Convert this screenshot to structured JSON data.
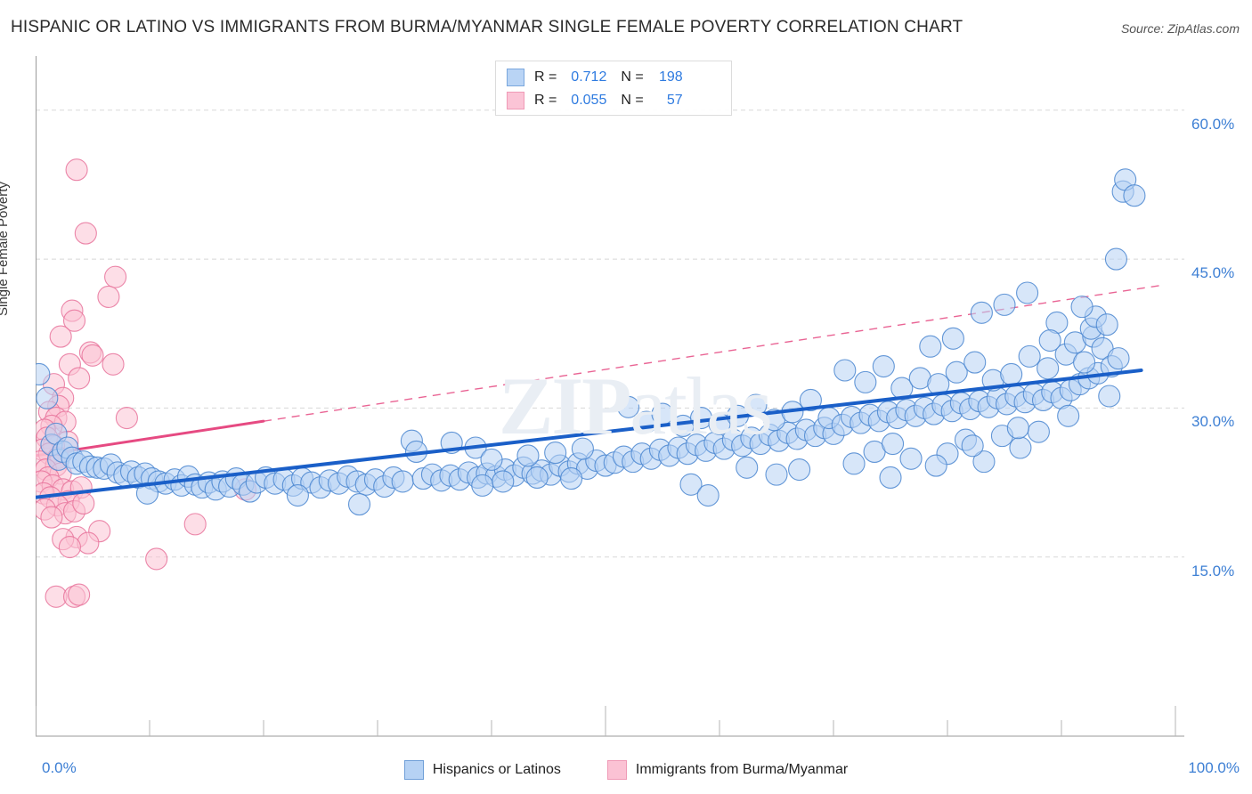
{
  "header": {
    "title": "HISPANIC OR LATINO VS IMMIGRANTS FROM BURMA/MYANMAR SINGLE FEMALE POVERTY CORRELATION CHART",
    "source": "Source: ZipAtlas.com"
  },
  "watermark": {
    "part1": "ZIP",
    "part2": "atlas"
  },
  "correlation_legend": {
    "rows": [
      {
        "color": "#b9d4f5",
        "r_label": "R =",
        "r_value": "0.712",
        "n_label": "N =",
        "n_value": "198"
      },
      {
        "color": "#fbc4d6",
        "r_label": "R =",
        "r_value": "0.055",
        "n_label": "N =",
        "n_value": "57"
      }
    ]
  },
  "series_legend": [
    {
      "name": "Hispanics or Latinos",
      "color": "#b6d2f4"
    },
    {
      "name": "Immigrants from Burma/Myanmar",
      "color": "#fbc2d4"
    }
  ],
  "axes": {
    "y_title": "Single Female Poverty",
    "y_ticks": [
      "60.0%",
      "45.0%",
      "30.0%",
      "15.0%"
    ],
    "x_min_label": "0.0%",
    "x_max_label": "100.0%"
  },
  "chart_data": {
    "type": "scatter",
    "title": "HISPANIC OR LATINO VS IMMIGRANTS FROM BURMA/MYANMAR SINGLE FEMALE POVERTY CORRELATION CHART",
    "xlabel": "",
    "ylabel": "Single Female Poverty",
    "xlim": [
      0,
      100
    ],
    "ylim": [
      0,
      65
    ],
    "x_ticks": [
      0,
      100
    ],
    "y_ticks": [
      15,
      30,
      45,
      60
    ],
    "grid": "horizontal-dashed",
    "legend_position": "bottom-center",
    "series": [
      {
        "name": "Hispanics or Latinos",
        "color": "#b6d2f4",
        "edge_color": "#4a86d0",
        "r": 0.712,
        "n": 198,
        "trendline": {
          "style": "solid",
          "color": "#1a5fc8",
          "x0": 0,
          "y0": 21.0,
          "x1": 97,
          "y1": 33.8
        },
        "points": [
          [
            0.3,
            33.4
          ],
          [
            1.0,
            31.0
          ],
          [
            1.4,
            26.3
          ],
          [
            1.8,
            27.4
          ],
          [
            2.0,
            24.8
          ],
          [
            2.4,
            25.6
          ],
          [
            2.8,
            26.0
          ],
          [
            3.2,
            25.0
          ],
          [
            3.6,
            24.4
          ],
          [
            4.2,
            24.6
          ],
          [
            4.8,
            24.1
          ],
          [
            5.4,
            24.0
          ],
          [
            6.0,
            23.9
          ],
          [
            6.6,
            24.3
          ],
          [
            7.2,
            23.5
          ],
          [
            7.8,
            23.2
          ],
          [
            8.4,
            23.6
          ],
          [
            9.0,
            23.0
          ],
          [
            9.6,
            23.4
          ],
          [
            10.2,
            22.9
          ],
          [
            10.8,
            22.6
          ],
          [
            11.4,
            22.4
          ],
          [
            9.8,
            21.4
          ],
          [
            12.2,
            22.8
          ],
          [
            12.8,
            22.2
          ],
          [
            13.4,
            23.1
          ],
          [
            14.0,
            22.3
          ],
          [
            14.6,
            22.0
          ],
          [
            15.2,
            22.5
          ],
          [
            15.8,
            21.8
          ],
          [
            16.4,
            22.6
          ],
          [
            17.0,
            22.1
          ],
          [
            17.6,
            22.9
          ],
          [
            18.2,
            22.3
          ],
          [
            18.8,
            21.6
          ],
          [
            19.4,
            22.5
          ],
          [
            20.2,
            23.0
          ],
          [
            21.0,
            22.4
          ],
          [
            21.8,
            22.8
          ],
          [
            22.6,
            22.2
          ],
          [
            23.4,
            22.9
          ],
          [
            24.2,
            22.5
          ],
          [
            25.0,
            22.0
          ],
          [
            25.8,
            22.7
          ],
          [
            26.6,
            22.4
          ],
          [
            27.4,
            23.1
          ],
          [
            28.2,
            22.6
          ],
          [
            23.0,
            21.2
          ],
          [
            29.0,
            22.3
          ],
          [
            29.8,
            22.8
          ],
          [
            30.6,
            22.1
          ],
          [
            31.4,
            23.0
          ],
          [
            28.4,
            20.3
          ],
          [
            32.2,
            22.6
          ],
          [
            33.0,
            26.7
          ],
          [
            33.4,
            25.6
          ],
          [
            34.0,
            22.9
          ],
          [
            34.8,
            23.3
          ],
          [
            35.6,
            22.7
          ],
          [
            36.4,
            23.2
          ],
          [
            37.2,
            22.8
          ],
          [
            38.0,
            23.5
          ],
          [
            38.8,
            23.0
          ],
          [
            39.6,
            23.4
          ],
          [
            40.4,
            23.1
          ],
          [
            41.2,
            23.8
          ],
          [
            42.0,
            23.2
          ],
          [
            42.8,
            24.0
          ],
          [
            43.6,
            23.4
          ],
          [
            44.4,
            23.7
          ],
          [
            45.2,
            23.3
          ],
          [
            46.0,
            24.2
          ],
          [
            46.8,
            23.6
          ],
          [
            47.6,
            24.4
          ],
          [
            48.4,
            23.9
          ],
          [
            49.2,
            24.7
          ],
          [
            50.0,
            24.2
          ],
          [
            36.5,
            26.5
          ],
          [
            38.6,
            26.0
          ],
          [
            39.2,
            22.2
          ],
          [
            40.0,
            24.8
          ],
          [
            41.0,
            22.6
          ],
          [
            43.2,
            25.2
          ],
          [
            44.0,
            23.0
          ],
          [
            45.6,
            25.5
          ],
          [
            47.0,
            22.9
          ],
          [
            48.0,
            25.9
          ],
          [
            50.8,
            24.5
          ],
          [
            51.6,
            25.1
          ],
          [
            52.4,
            24.6
          ],
          [
            53.2,
            25.4
          ],
          [
            54.0,
            24.9
          ],
          [
            54.8,
            25.8
          ],
          [
            55.6,
            25.2
          ],
          [
            56.4,
            26.0
          ],
          [
            57.2,
            25.4
          ],
          [
            58.0,
            26.3
          ],
          [
            58.8,
            25.7
          ],
          [
            59.6,
            26.5
          ],
          [
            60.4,
            25.9
          ],
          [
            61.2,
            26.8
          ],
          [
            62.0,
            26.2
          ],
          [
            62.8,
            27.0
          ],
          [
            63.6,
            26.4
          ],
          [
            64.4,
            27.3
          ],
          [
            65.2,
            26.7
          ],
          [
            66.0,
            27.5
          ],
          [
            66.8,
            26.9
          ],
          [
            67.6,
            27.8
          ],
          [
            68.4,
            27.2
          ],
          [
            69.2,
            28.0
          ],
          [
            70.0,
            27.4
          ],
          [
            52.0,
            30.1
          ],
          [
            53.6,
            28.6
          ],
          [
            55.0,
            29.4
          ],
          [
            56.8,
            28.2
          ],
          [
            58.4,
            29.0
          ],
          [
            60.0,
            28.4
          ],
          [
            61.6,
            29.2
          ],
          [
            63.2,
            30.3
          ],
          [
            64.8,
            28.8
          ],
          [
            66.4,
            29.6
          ],
          [
            68.0,
            30.8
          ],
          [
            69.6,
            29.0
          ],
          [
            57.5,
            22.3
          ],
          [
            59.0,
            21.2
          ],
          [
            62.4,
            24.0
          ],
          [
            65.0,
            23.3
          ],
          [
            70.8,
            28.3
          ],
          [
            71.6,
            29.1
          ],
          [
            72.4,
            28.5
          ],
          [
            73.2,
            29.3
          ],
          [
            74.0,
            28.7
          ],
          [
            74.8,
            29.6
          ],
          [
            75.6,
            29.0
          ],
          [
            76.4,
            29.8
          ],
          [
            77.2,
            29.2
          ],
          [
            78.0,
            30.0
          ],
          [
            78.8,
            29.4
          ],
          [
            79.6,
            30.3
          ],
          [
            80.4,
            29.7
          ],
          [
            81.2,
            30.5
          ],
          [
            82.0,
            29.9
          ],
          [
            82.8,
            30.7
          ],
          [
            83.6,
            30.1
          ],
          [
            84.4,
            31.0
          ],
          [
            85.2,
            30.4
          ],
          [
            86.0,
            31.2
          ],
          [
            86.8,
            30.6
          ],
          [
            87.6,
            31.4
          ],
          [
            88.4,
            30.8
          ],
          [
            89.2,
            31.6
          ],
          [
            90.0,
            31.0
          ],
          [
            71.0,
            33.8
          ],
          [
            72.8,
            32.6
          ],
          [
            74.4,
            34.2
          ],
          [
            76.0,
            32.0
          ],
          [
            77.6,
            33.0
          ],
          [
            79.2,
            32.4
          ],
          [
            80.8,
            33.6
          ],
          [
            82.4,
            34.6
          ],
          [
            84.0,
            32.8
          ],
          [
            85.6,
            33.4
          ],
          [
            87.2,
            35.2
          ],
          [
            88.8,
            34.0
          ],
          [
            73.6,
            25.6
          ],
          [
            75.2,
            26.4
          ],
          [
            76.8,
            24.9
          ],
          [
            80.0,
            25.4
          ],
          [
            81.6,
            26.8
          ],
          [
            83.2,
            24.6
          ],
          [
            84.8,
            27.2
          ],
          [
            86.4,
            26.0
          ],
          [
            88.0,
            27.6
          ],
          [
            90.8,
            31.8
          ],
          [
            91.6,
            32.4
          ],
          [
            92.4,
            33.0
          ],
          [
            93.2,
            33.5
          ],
          [
            90.4,
            35.4
          ],
          [
            91.2,
            36.6
          ],
          [
            92.0,
            34.6
          ],
          [
            92.8,
            37.2
          ],
          [
            93.6,
            36.0
          ],
          [
            94.4,
            34.2
          ],
          [
            89.6,
            38.6
          ],
          [
            92.6,
            38.0
          ],
          [
            93.0,
            39.2
          ],
          [
            94.0,
            38.4
          ],
          [
            83.0,
            39.6
          ],
          [
            87.0,
            41.6
          ],
          [
            85.0,
            40.4
          ],
          [
            80.5,
            37.0
          ],
          [
            78.5,
            36.2
          ],
          [
            94.8,
            45.0
          ],
          [
            95.4,
            51.8
          ],
          [
            95.6,
            53.0
          ],
          [
            96.4,
            51.4
          ],
          [
            91.8,
            40.2
          ],
          [
            89.0,
            36.8
          ],
          [
            95.0,
            35.0
          ],
          [
            94.2,
            31.2
          ],
          [
            90.6,
            29.2
          ],
          [
            86.2,
            28.0
          ],
          [
            82.2,
            26.2
          ],
          [
            79.0,
            24.2
          ],
          [
            75.0,
            23.0
          ],
          [
            67.0,
            23.8
          ],
          [
            71.8,
            24.4
          ]
        ]
      },
      {
        "name": "Immigrants from Burma/Myanmar",
        "color": "#fbc2d4",
        "edge_color": "#e8739b",
        "r": 0.055,
        "n": 57,
        "trendline": {
          "style": "solid-then-dashed",
          "color": "#e64a82",
          "x0": 0,
          "y0": 25.2,
          "x_solid_end": 20,
          "x1": 99,
          "y1": 42.4
        },
        "points": [
          [
            3.6,
            54.0
          ],
          [
            4.4,
            47.6
          ],
          [
            7.0,
            43.2
          ],
          [
            6.4,
            41.2
          ],
          [
            3.2,
            39.8
          ],
          [
            3.4,
            38.8
          ],
          [
            2.2,
            37.2
          ],
          [
            4.8,
            35.6
          ],
          [
            5.0,
            35.3
          ],
          [
            3.0,
            34.4
          ],
          [
            3.8,
            33.0
          ],
          [
            1.6,
            32.4
          ],
          [
            8.0,
            29.0
          ],
          [
            2.4,
            31.0
          ],
          [
            2.0,
            30.2
          ],
          [
            1.2,
            29.6
          ],
          [
            1.8,
            29.0
          ],
          [
            2.6,
            28.6
          ],
          [
            1.4,
            28.2
          ],
          [
            0.8,
            27.8
          ],
          [
            1.0,
            27.0
          ],
          [
            2.8,
            26.6
          ],
          [
            1.6,
            26.2
          ],
          [
            0.6,
            25.8
          ],
          [
            1.2,
            25.4
          ],
          [
            2.0,
            25.0
          ],
          [
            0.4,
            24.6
          ],
          [
            1.8,
            24.2
          ],
          [
            0.9,
            23.8
          ],
          [
            2.2,
            23.4
          ],
          [
            1.1,
            23.0
          ],
          [
            0.5,
            22.6
          ],
          [
            1.5,
            22.2
          ],
          [
            2.4,
            21.8
          ],
          [
            0.7,
            21.4
          ],
          [
            1.3,
            21.0
          ],
          [
            3.2,
            21.6
          ],
          [
            4.0,
            22.0
          ],
          [
            18.4,
            21.8
          ],
          [
            2.9,
            20.6
          ],
          [
            1.9,
            20.2
          ],
          [
            0.8,
            19.8
          ],
          [
            2.6,
            19.4
          ],
          [
            1.4,
            19.0
          ],
          [
            3.4,
            19.6
          ],
          [
            4.2,
            20.4
          ],
          [
            14.0,
            18.3
          ],
          [
            5.6,
            17.6
          ],
          [
            3.6,
            17.0
          ],
          [
            4.6,
            16.4
          ],
          [
            2.4,
            16.8
          ],
          [
            3.0,
            16.0
          ],
          [
            10.6,
            14.8
          ],
          [
            1.8,
            11.0
          ],
          [
            3.4,
            11.0
          ],
          [
            3.8,
            11.2
          ],
          [
            6.8,
            34.4
          ]
        ]
      }
    ]
  }
}
